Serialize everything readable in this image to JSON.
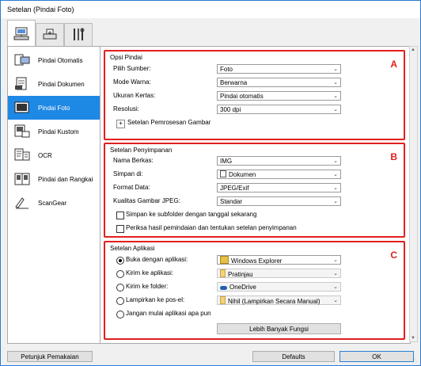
{
  "window": {
    "title": "Setelan (Pindai Foto)"
  },
  "tabs": [
    {
      "icon": "scanner-computer-icon"
    },
    {
      "icon": "scanner-icon"
    },
    {
      "icon": "tools-icon"
    }
  ],
  "sidebar": {
    "items": [
      {
        "label": "Pindai Otomatis",
        "icon": "auto-scan-icon"
      },
      {
        "label": "Pindai Dokumen",
        "icon": "document-scan-icon"
      },
      {
        "label": "Pindai Foto",
        "icon": "photo-scan-icon",
        "selected": true
      },
      {
        "label": "Pindai Kustom",
        "icon": "custom-scan-icon"
      },
      {
        "label": "OCR",
        "icon": "ocr-icon"
      },
      {
        "label": "Pindai dan Rangkai",
        "icon": "stitch-icon"
      },
      {
        "label": "ScanGear",
        "icon": "scangear-icon"
      }
    ]
  },
  "scan_options": {
    "title": "Opsi Pindai",
    "marker": "A",
    "source_label": "Pilih Sumber:",
    "source_value": "Foto",
    "color_label": "Mode Warna:",
    "color_value": "Berwarna",
    "paper_label": "Ukuran Kertas:",
    "paper_value": "Pindai otomatis",
    "resolution_label": "Resolusi:",
    "resolution_value": "300 dpi",
    "processing_label": "Setelan Pemrosesan Gambar"
  },
  "save_settings": {
    "title": "Setelan Penyimpanan",
    "marker": "B",
    "filename_label": "Nama Berkas:",
    "filename_value": "IMG",
    "saveto_label": "Simpan di:",
    "saveto_value": "Dokumen",
    "format_label": "Format Data:",
    "format_value": "JPEG/Exif",
    "quality_label": "Kualitas Gambar JPEG:",
    "quality_value": "Standar",
    "subfolder_label": "Simpan ke subfolder dengan tanggal sekarang",
    "check_label": "Periksa hasil pemindaian dan tentukan setelan penyimpanan"
  },
  "app_settings": {
    "title": "Setelan Aplikasi",
    "marker": "C",
    "open_label": "Buka dengan aplikasi:",
    "open_value": "Windows Explorer",
    "send_app_label": "Kirim ke aplikasi:",
    "send_app_value": "Pratinjau",
    "send_folder_label": "Kirim ke folder:",
    "send_folder_value": "OneDrive",
    "attach_label": "Lampirkan ke pos-el:",
    "attach_value": "Nihil (Lampirkan Secara Manual)",
    "none_label": "Jangan mulai aplikasi apa pun",
    "more_button": "Lebih Banyak Fungsi"
  },
  "footer": {
    "manual_button": "Petunjuk Pemakaian",
    "defaults_button": "Defaults",
    "ok_button": "OK"
  },
  "colors": {
    "accent": "#1e88e5",
    "marker": "#e0201e"
  }
}
